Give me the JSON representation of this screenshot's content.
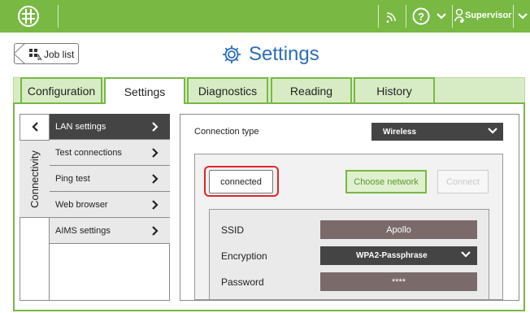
{
  "topbar": {
    "user_label": "Supervisor",
    "icons": [
      "globe-logo-icon",
      "wifi-signal-icon",
      "help-icon",
      "chevron-down-icon",
      "user-key-icon",
      "chevron-down-icon"
    ]
  },
  "header": {
    "back_label": "Job list",
    "title": "Settings"
  },
  "tabs": [
    {
      "label": "Configuration",
      "active": false
    },
    {
      "label": "Settings",
      "active": true
    },
    {
      "label": "Diagnostics",
      "active": false
    },
    {
      "label": "Reading",
      "active": false
    },
    {
      "label": "History",
      "active": false
    }
  ],
  "sidebar": {
    "group_label": "Connectivity",
    "items": [
      {
        "label": "LAN settings",
        "active": true
      },
      {
        "label": "Test connections",
        "active": false
      },
      {
        "label": "Ping test",
        "active": false
      },
      {
        "label": "Web browser",
        "active": false
      },
      {
        "label": "AIMS settings",
        "active": false
      }
    ]
  },
  "lan": {
    "connection_type_label": "Connection type",
    "connection_type_value": "Wireless",
    "status_value": "connected",
    "choose_network_label": "Choose network",
    "connect_label": "Connect",
    "ssid_label": "SSID",
    "ssid_value": "Apollo",
    "encryption_label": "Encryption",
    "encryption_value": "WPA2-Passphrase",
    "password_label": "Password",
    "password_value": "****"
  },
  "colors": {
    "accent_green": "#78b843",
    "tab_bg": "#d7ecc5",
    "title_blue": "#2b6eb3",
    "highlight_red": "#e0262b",
    "dark_control": "#444444"
  }
}
